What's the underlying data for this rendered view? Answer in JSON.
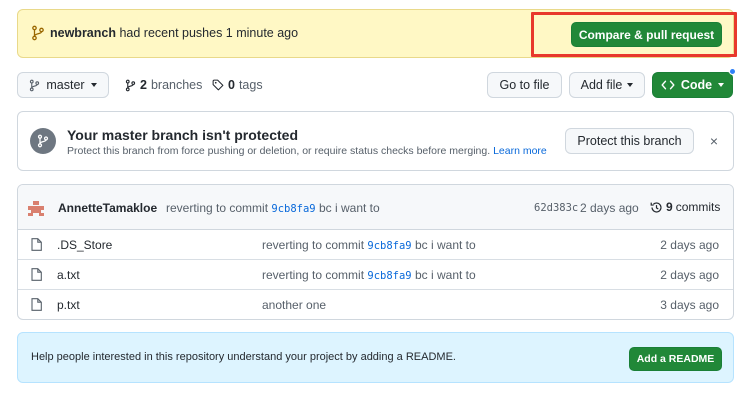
{
  "banner": {
    "branch_name": "newbranch",
    "message": " had recent pushes 1 minute ago",
    "compare_button": "Compare & pull request",
    "colors": {
      "background": "#fff8c5",
      "highlight_outline": "#e8382c",
      "primary_button": "#218838"
    }
  },
  "toolbar": {
    "current_branch": "master",
    "branches_count": "2",
    "branches_label": "branches",
    "tags_count": "0",
    "tags_label": "tags",
    "goto_file": "Go to file",
    "add_file": "Add file",
    "code": "Code",
    "icons": {
      "branch": "git-branch-icon",
      "tag": "tag-icon",
      "code": "code-icon"
    }
  },
  "protect": {
    "title": "Your master branch isn't protected",
    "description": "Protect this branch from force pushing or deletion, or require status checks before merging.",
    "learn_more": "Learn more",
    "button": "Protect this branch",
    "dismiss": "×"
  },
  "latest_commit": {
    "author": "AnnetteTamakloe",
    "message_prefix": "reverting to commit",
    "message_sha": "9cb8fa9",
    "message_suffix": "bc i want to",
    "sha": "62d383c",
    "age": "2 days ago",
    "commits_count": "9",
    "commits_label": "commits"
  },
  "files": [
    {
      "name": ".DS_Store",
      "msg_prefix": "reverting to commit",
      "msg_sha": "9cb8fa9",
      "msg_suffix": "bc i want to",
      "age": "2 days ago"
    },
    {
      "name": "a.txt",
      "msg_prefix": "reverting to commit",
      "msg_sha": "9cb8fa9",
      "msg_suffix": "bc i want to",
      "age": "2 days ago"
    },
    {
      "name": "p.txt",
      "msg_prefix": "another one",
      "msg_sha": "",
      "msg_suffix": "",
      "age": "3 days ago"
    }
  ],
  "readme": {
    "message": "Help people interested in this repository understand your project by adding a README.",
    "button": "Add a README"
  }
}
